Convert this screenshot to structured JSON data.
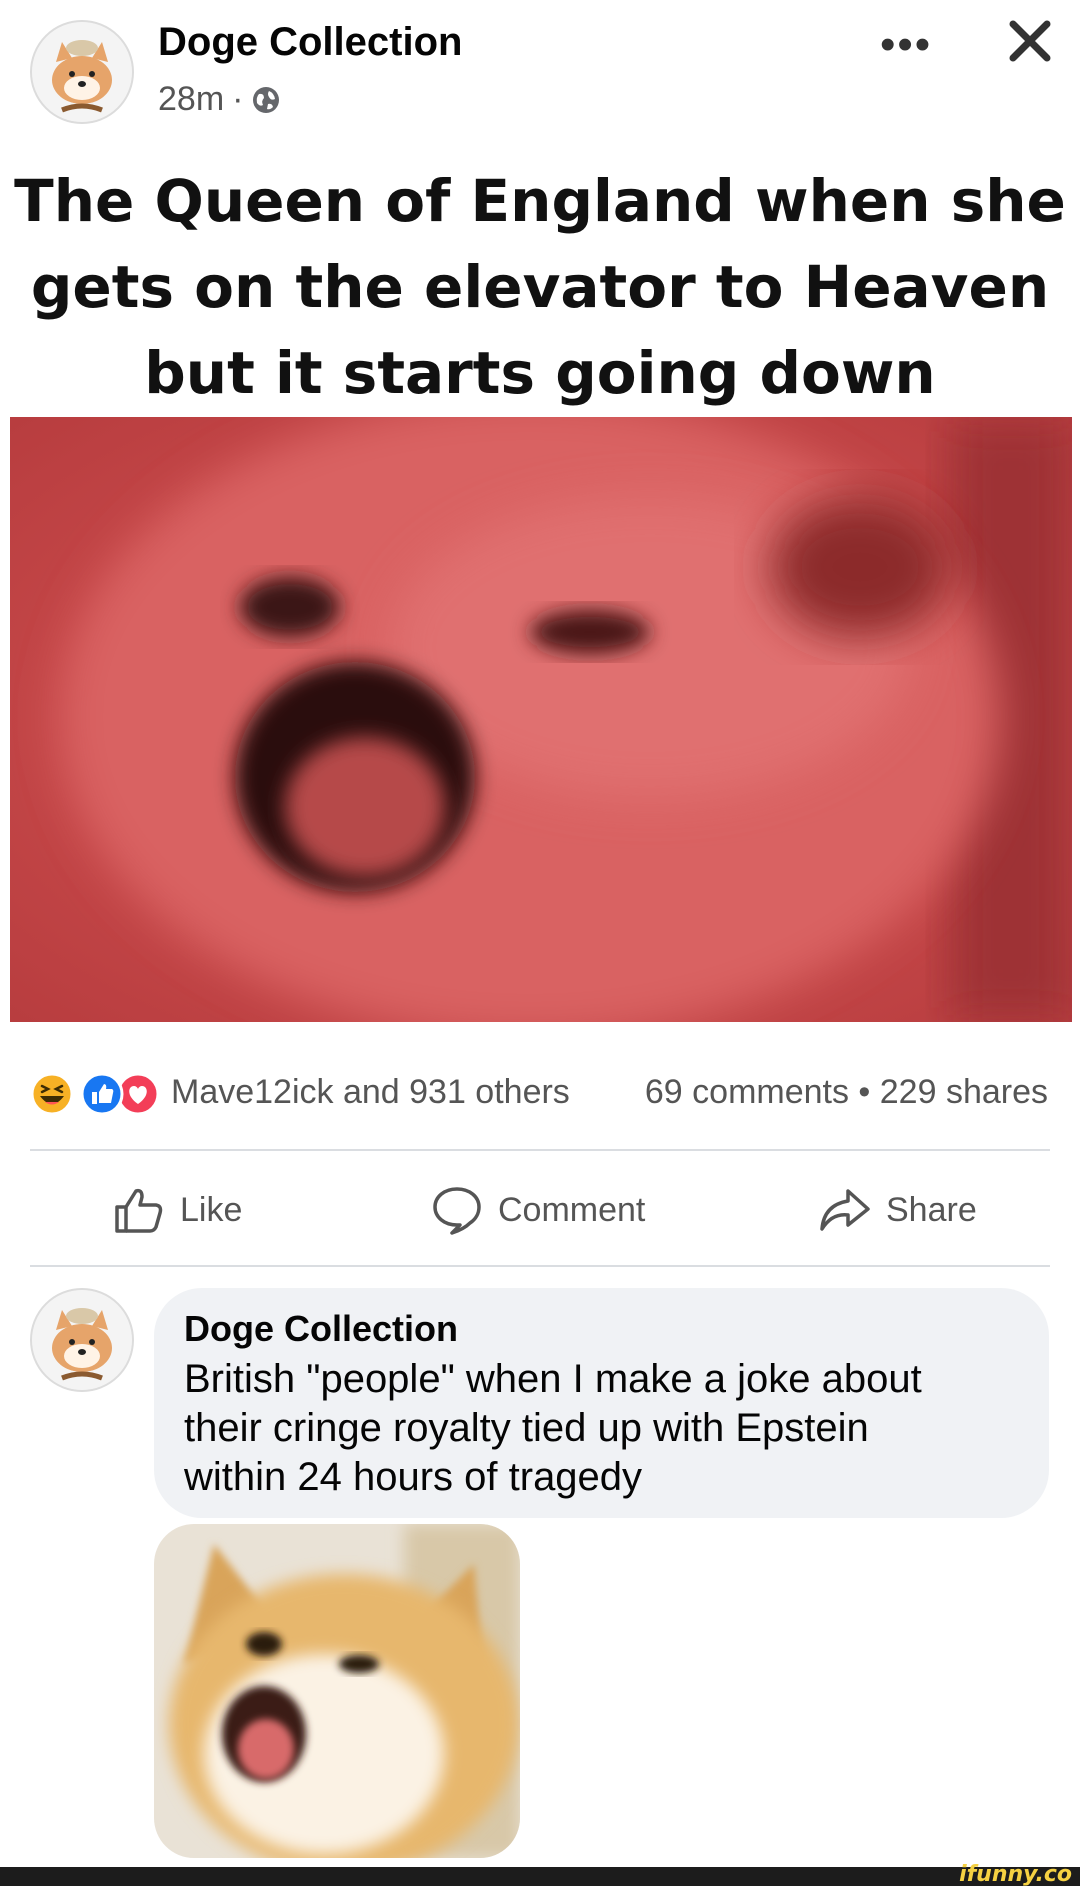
{
  "post": {
    "page_name": "Doge Collection",
    "time": "28m",
    "separator": "·",
    "privacy_icon": "globe-icon",
    "more_icon": "more-options-icon",
    "more_label": "•••",
    "close_icon": "close-icon",
    "caption_lines": [
      "The Queen of England when she",
      "gets on the elevator to Heaven",
      "but it starts going down"
    ]
  },
  "reactions": {
    "icons": [
      "laugh-reaction-icon",
      "like-reaction-icon",
      "love-reaction-icon"
    ],
    "text": "Mave12ick and 931 others",
    "counts": "69 comments • 229 shares"
  },
  "actions": {
    "like": "Like",
    "comment": "Comment",
    "share": "Share"
  },
  "comment": {
    "author": "Doge Collection",
    "text_lines": [
      "British \"people\" when I make a joke about",
      "their cringe royalty tied up with Epstein",
      "within 24 hours of tragedy"
    ]
  },
  "watermark": "ifunny.co",
  "colors": {
    "image_tint": "#c9494a",
    "bubble_bg": "#f0f2f5",
    "like_blue": "#1877f2",
    "love_red": "#f33e58",
    "laugh_yellow": "#f7b125",
    "watermark_yellow": "#f5d142"
  }
}
